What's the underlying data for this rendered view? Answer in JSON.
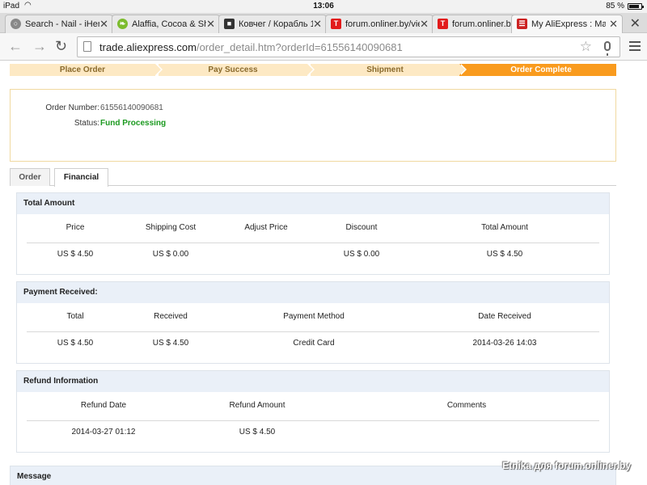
{
  "status_bar": {
    "carrier": "iPad",
    "time": "13:06",
    "battery_pct": "85 %",
    "battery_level": 0.85
  },
  "browser": {
    "tabs": [
      {
        "label": "Search - Nail - iHerb",
        "favicon": "globe-icon",
        "color": "#777777",
        "active": false
      },
      {
        "label": "Alaffia, Cocoa & She",
        "favicon": "leaf-icon",
        "color": "#7cbc2e",
        "active": false
      },
      {
        "label": "Ковчег / Корабль 1",
        "favicon": "clapper-icon",
        "color": "#333333",
        "active": false
      },
      {
        "label": "forum.onliner.by/view",
        "favicon": "onliner-icon",
        "color": "#e21b1b",
        "active": false
      },
      {
        "label": "forum.onliner.by",
        "favicon": "onliner-icon",
        "color": "#e21b1b",
        "active": false
      },
      {
        "label": "My AliExpress : Man",
        "favicon": "cart-icon",
        "color": "#cc2222",
        "active": true
      }
    ],
    "url_host": "trade.aliexpress.com",
    "url_path": "/order_detail.htm?orderId=61556140090681"
  },
  "steps": [
    {
      "label": "Place Order",
      "done": false
    },
    {
      "label": "Pay Success",
      "done": false
    },
    {
      "label": "Shipment",
      "done": false
    },
    {
      "label": "Order Complete",
      "done": true
    }
  ],
  "order": {
    "number_label": "Order Number:",
    "number": "61556140090681",
    "status_label": "Status:",
    "status": "Fund Processing"
  },
  "page_tabs": [
    {
      "label": "Order",
      "active": false
    },
    {
      "label": "Financial",
      "active": true
    }
  ],
  "total_amount": {
    "title": "Total Amount",
    "headers": [
      "Price",
      "Shipping Cost",
      "Adjust Price",
      "Discount",
      "Total Amount"
    ],
    "values": [
      "US $ 4.50",
      "US $ 0.00",
      "",
      "US $ 0.00",
      "US $ 4.50"
    ]
  },
  "payment_received": {
    "title": "Payment Received:",
    "headers": [
      "Total",
      "Received",
      "Payment Method",
      "Date Received"
    ],
    "values": [
      "US $ 4.50",
      "US $ 4.50",
      "Credit Card",
      "2014-03-26 14:03"
    ]
  },
  "refund": {
    "title": "Refund Information",
    "headers": [
      "Refund Date",
      "Refund Amount",
      "Comments"
    ],
    "values": [
      "2014-03-27 01:12",
      "US $ 4.50",
      ""
    ]
  },
  "message": {
    "title": "Message"
  },
  "watermark": "Etnika для forum.onliner.by"
}
